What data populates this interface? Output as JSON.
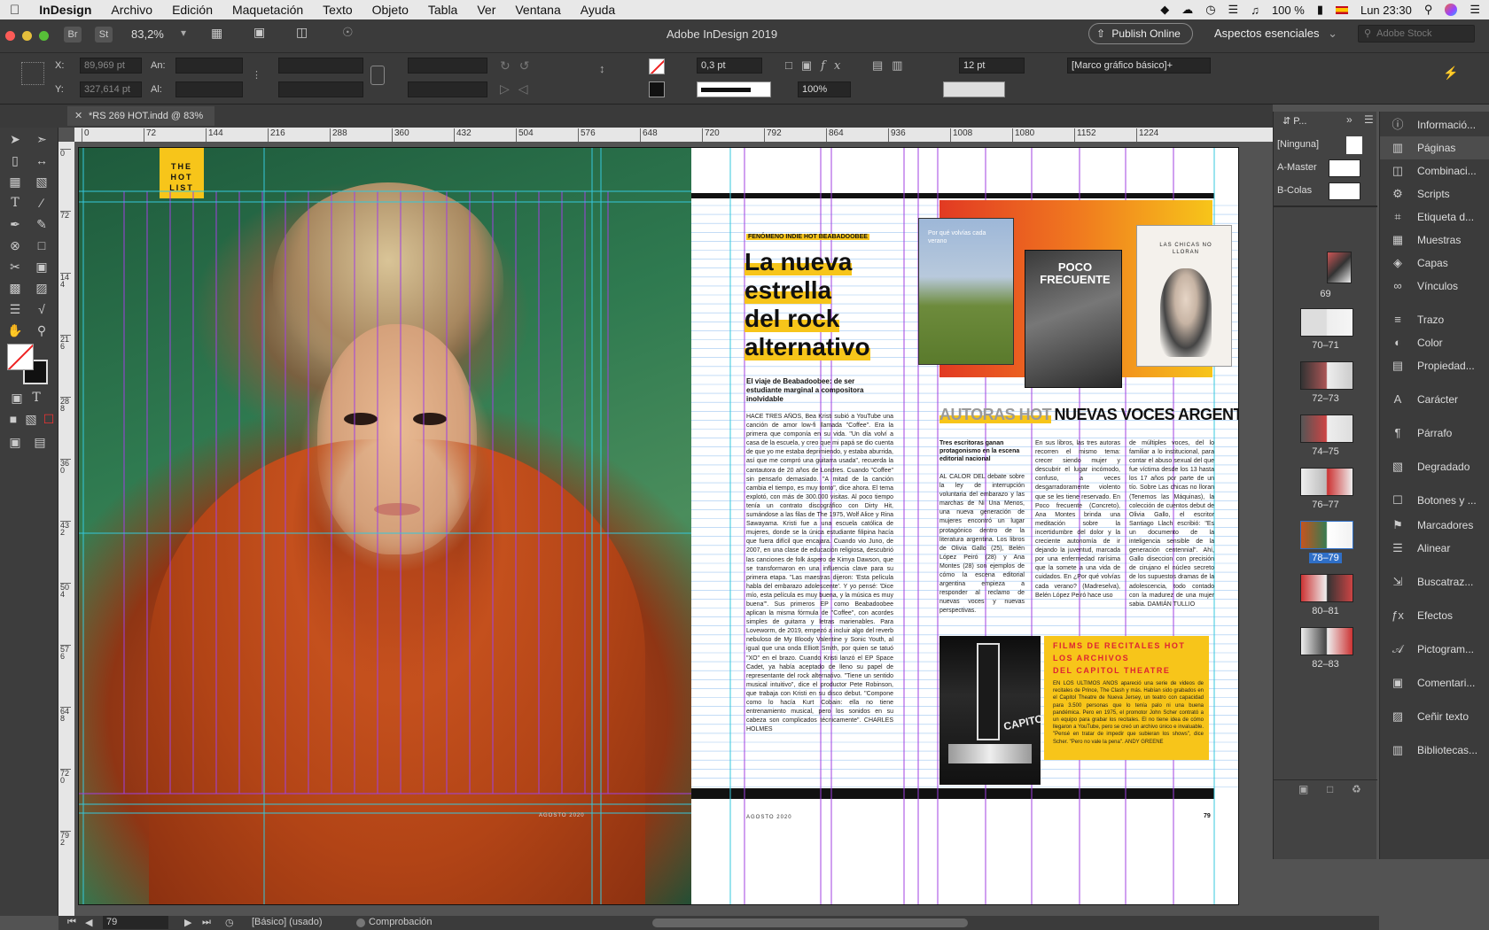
{
  "menubar": {
    "app_name": "InDesign",
    "items": [
      "Archivo",
      "Edición",
      "Maquetación",
      "Texto",
      "Objeto",
      "Tabla",
      "Ver",
      "Ventana",
      "Ayuda"
    ],
    "battery": "100 %",
    "clock": "Lun 23:30"
  },
  "appbar": {
    "title": "Adobe InDesign 2019",
    "zoom": "83,2%",
    "br_label": "Br",
    "st_label": "St",
    "publish_label": "Publish Online",
    "workspace_label": "Aspectos esenciales",
    "search_placeholder": "Adobe Stock"
  },
  "control": {
    "x_label": "X:",
    "x_value": "89,969 pt",
    "y_label": "Y:",
    "y_value": "327,614 pt",
    "w_label": "An:",
    "h_label": "Al:",
    "stroke_weight": "0,3 pt",
    "scale": "100%",
    "gutter": "12 pt",
    "object_style": "[Marco gráfico básico]+"
  },
  "document": {
    "tab_label": "*RS 269 HOT.indd @ 83%"
  },
  "ruler": {
    "ticks": [
      "0",
      "72",
      "144",
      "216",
      "288",
      "360",
      "432",
      "504",
      "576",
      "648",
      "720",
      "792",
      "864",
      "936",
      "1008",
      "1080",
      "1152",
      "1224"
    ],
    "v_ticks": [
      "0",
      "72",
      "144",
      "216",
      "288",
      "360",
      "432",
      "504",
      "576",
      "648",
      "720",
      "792"
    ]
  },
  "spread": {
    "hotlist_label": "THE HOT LIST",
    "kicker": "FENÓMENO INDIE HOT BEABADOOBEE",
    "headline": [
      "La nueva",
      "estrella",
      "del rock",
      "alternativo"
    ],
    "deck": "El viaje de Beabadoobee: de ser estudiante marginal a compositora inolvidable",
    "body": "HACE TRES AÑOS, Bea Kristi subió a YouTube una canción de amor low-fi llamada \"Coffee\". Era la primera que componía en su vida. \"Un día volví a casa de la escuela, y creo que mi papá se dio cuenta de que yo me estaba deprimiendo, y estaba aburrida, así que me compró una guitarra usada\", recuerda la cantautora de 20 años de Londres. Cuando \"Coffee\" sin pensarlo demasiado. \"A mitad de la canción cambia el tiempo, es muy tonto\", dice ahora. El tema explotó, con más de 300.000 visitas. Al poco tiempo tenía un contrato discográfico con Dirty Hit, sumándose a las filas de The 1975, Wolf Alice y Rina Sawayama. Kristi fue a una escuela católica de mujeres, donde se la única estudiante filipina hacía que fuera difícil que encajara. Cuando vio Juno, de 2007, en una clase de educación religiosa, descubrió las canciones de folk áspero de Kimya Dawson, que se transformaron en una influencia clave para su primera etapa. \"Las maestras dijeron: 'Esta película habla del embarazo adolescente'. Y yo pensé: 'Dice mío, esta película es muy buena, y la música es muy buena'\". Sus primeros EP como Beabadoobee aplican la misma fórmula de \"Coffee\", con acordes simples de guitarra y letras marienables. Para Loveworm, de 2019, empezó a incluir algo del reverb nebuloso de My Bloody Valentine y Sonic Youth, al igual que una onda Elliott Smith, por quien se tatuó \"XO\" en el brazo. Cuando Kristi lanzó el EP Space Cadet, ya había aceptado de lleno su papel de representante del rock alternativo. \"Tiene un sentido musical intuitivo\", dice el productor Pete Robinson, que trabaja con Kristi en su disco debut. \"Compone como lo hacía Kurt Cobain: ella no tiene entrenamiento musical, pero los sonidos en su cabeza son complicados técnicamente\". CHARLES HOLMES",
    "book1_title": "Por qué volvías cada verano",
    "book2_title": "POCO FRECUENTE",
    "book3_title": "LAS CHICAS NO LLORAN",
    "section_grey": "AUTORAS HOT",
    "section_title": "NUEVAS VOCES ARGENTINAS",
    "section_deck": "Tres escritoras ganan protagonismo en la escena editorial nacional",
    "col1": "AL CALOR DEL debate sobre la ley de interrupción voluntaria del embarazo y las marchas de Ni Una Menos, una nueva generación de mujeres encontró un lugar protagónico dentro de la literatura argentina. Los libros de Olivia Gallo (25), Belén López Peiró (28) y Ana Montes (28) son ejemplos de cómo la escena editorial argentina empieza a responder al reclamo de nuevas voces y nuevas perspectivas.",
    "col2": "En sus libros, las tres autoras recorren el mismo tema: crecer siendo mujer y descubrir el lugar incómodo, confuso, a veces desgarradoramente violento que se les tiene reservado. En Poco frecuente (Concreto), Ana Montes brinda una meditación sobre la incertidumbre del dolor y la creciente autonomía de ir dejando la juventud, marcada por una enfermedad rarísima que la somete a una vida de cuidados. En ¿Por qué volvías cada verano? (Madreselva), Belén López Peiró hace uso",
    "col3": "de múltiples voces, del lo familiar a lo institucional, para contar el abuso sexual del que fue víctima desde los 13 hasta los 17 años por parte de un tío. Sobre Las chicas no lloran (Tenemos las Máquinas), la colección de cuentos debut de Olivia Gallo, el escritor Santiago Llach escribió: \"Es un documento de la inteligencia sensible de la generación centennial\". Ahí, Gallo diseccion con precisión de cirujano el núcleo secreto de los supuestos dramas de la adolescencia, todo contado con la madurez de una mujer sabia. DAMIÁN TULLIO",
    "capitol_sign": "CAPITOL",
    "capitol_head": [
      "FILMS DE RECITALES HOT",
      "LOS ARCHIVOS",
      "DEL CAPITOL THEATRE"
    ],
    "capitol_body": "EN LOS ÚLTIMOS AÑOS apareció una serie de videos de recitales de Prince, The Clash y más. Habían sido grabados en el Capitol Theatre de Nueva Jersey, un teatro con capacidad para 3.500 personas que lo tenía palo ni una buena pandémica. Pero en 1975, el promotor John Scher contrató a un equipo para grabar los recitales. El no tiene idea de cómo llegaron a YouTube, pero se creó un archivo único e invaluable. \"Pensé en tratar de impedir que subieran los shows\", dice Scher. \"Pero no vale la pena\". ANDY GREENE",
    "folio_left": "AGOSTO 2020",
    "folio_right": "AGOSTO 2020",
    "page_number": "79"
  },
  "pages_panel": {
    "tab_label": "P...",
    "none_label": "[Ninguna]",
    "master_a": "A-Master",
    "master_b": "B-Colas",
    "pages": [
      "69",
      "70–71",
      "72–73",
      "74–75",
      "76–77",
      "78–79",
      "80–81",
      "82–83"
    ],
    "selected": "78–79"
  },
  "dock": {
    "items": [
      "Informació...",
      "Páginas",
      "Combinaci...",
      "Scripts",
      "Etiqueta d...",
      "Muestras",
      "Capas",
      "Vínculos",
      "Trazo",
      "Color",
      "Propiedad...",
      "Carácter",
      "Párrafo",
      "Degradado",
      "Botones y ...",
      "Marcadores",
      "Alinear",
      "Buscatraz...",
      "Efectos",
      "Pictogram...",
      "Comentari...",
      "Ceñir texto",
      "Bibliotecas..."
    ]
  },
  "status": {
    "page": "79",
    "style": "[Básico] (usado)",
    "preflight": "Comprobación"
  },
  "colors": {
    "accent_yellow": "#f7c51a",
    "panel_dark": "#3b3b3b",
    "selection_blue": "#2f6fc7"
  }
}
